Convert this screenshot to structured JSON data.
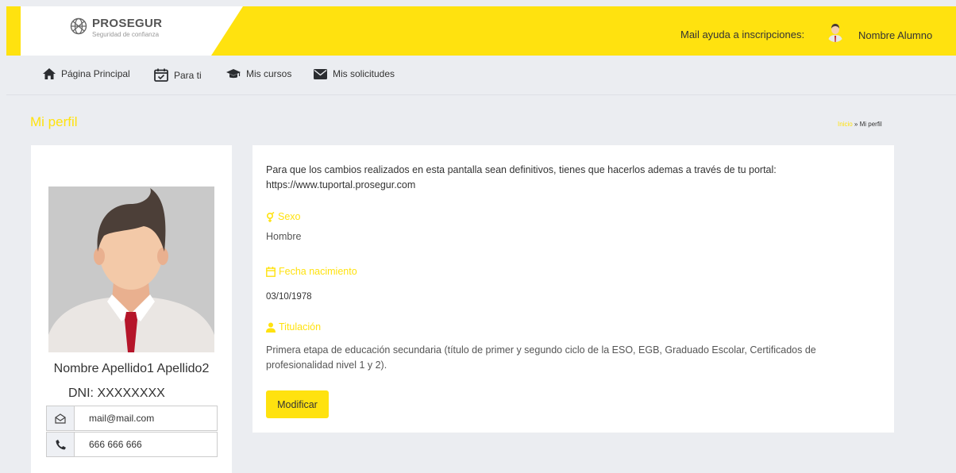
{
  "header": {
    "logo_name": "PROSEGUR",
    "logo_tagline": "Seguridad de confianza",
    "help_label": "Mail ayuda a inscripciones:",
    "user_name": "Nombre Alumno",
    "accent_color": "#ffe20f"
  },
  "nav": {
    "items": [
      {
        "label": "Página Principal",
        "icon": "home-icon"
      },
      {
        "label": "Para ti",
        "icon": "calendar-check-icon"
      },
      {
        "label": "Mis cursos",
        "icon": "graduation-cap-icon"
      },
      {
        "label": "Mis solicitudes",
        "icon": "envelope-icon"
      }
    ]
  },
  "page": {
    "title": "Mi perfil",
    "breadcrumb_link": "Inicio",
    "breadcrumb_sep": " » ",
    "breadcrumb_current": "Mi perfil"
  },
  "profile": {
    "full_name": "Nombre Apellido1 Apellido2",
    "dni_label": "DNI:",
    "dni_value": "XXXXXXXX",
    "email": "mail@mail.com",
    "phone": "666 666 666"
  },
  "details": {
    "intro": "Para que los cambios realizados en esta pantalla sean definitivos, tienes que hacerlos ademas a través de tu portal:",
    "portal_url": "https://www.tuportal.prosegur.com",
    "sex_label": "Sexo",
    "sex_value": "Hombre",
    "birth_label": "Fecha nacimiento",
    "birth_value": "03/10/1978",
    "degree_label": "Titulación",
    "degree_value": "Primera etapa de educación secundaria (título de primer y segundo ciclo de la ESO, EGB, Graduado Escolar, Certificados de profesionalidad nivel 1 y 2).",
    "modify_button": "Modificar"
  }
}
